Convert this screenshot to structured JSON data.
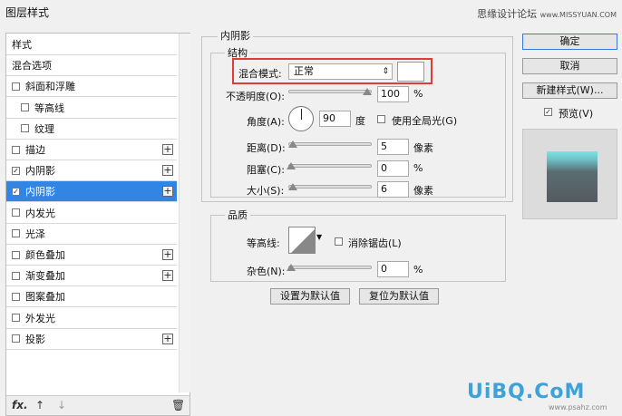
{
  "window": {
    "title": "图层样式",
    "watermark_top": "思缘设计论坛",
    "watermark_top_url": "www.MISSYUAN.COM"
  },
  "left_list": {
    "items": [
      {
        "label": "样式",
        "checkbox": false,
        "checked": false,
        "plus": false,
        "indent": 0,
        "selected": false
      },
      {
        "label": "混合选项",
        "checkbox": false,
        "checked": false,
        "plus": false,
        "indent": 0,
        "selected": false
      },
      {
        "label": "斜面和浮雕",
        "checkbox": true,
        "checked": false,
        "plus": false,
        "indent": 0,
        "selected": false
      },
      {
        "label": "等高线",
        "checkbox": true,
        "checked": false,
        "plus": false,
        "indent": 1,
        "selected": false
      },
      {
        "label": "纹理",
        "checkbox": true,
        "checked": false,
        "plus": false,
        "indent": 1,
        "selected": false
      },
      {
        "label": "描边",
        "checkbox": true,
        "checked": false,
        "plus": true,
        "indent": 0,
        "selected": false
      },
      {
        "label": "内阴影",
        "checkbox": true,
        "checked": true,
        "plus": true,
        "indent": 0,
        "selected": false
      },
      {
        "label": "内阴影",
        "checkbox": true,
        "checked": true,
        "plus": true,
        "indent": 0,
        "selected": true
      },
      {
        "label": "内发光",
        "checkbox": true,
        "checked": false,
        "plus": false,
        "indent": 0,
        "selected": false
      },
      {
        "label": "光泽",
        "checkbox": true,
        "checked": false,
        "plus": false,
        "indent": 0,
        "selected": false
      },
      {
        "label": "颜色叠加",
        "checkbox": true,
        "checked": false,
        "plus": true,
        "indent": 0,
        "selected": false
      },
      {
        "label": "渐变叠加",
        "checkbox": true,
        "checked": false,
        "plus": true,
        "indent": 0,
        "selected": false
      },
      {
        "label": "图案叠加",
        "checkbox": true,
        "checked": false,
        "plus": false,
        "indent": 0,
        "selected": false
      },
      {
        "label": "外发光",
        "checkbox": true,
        "checked": false,
        "plus": false,
        "indent": 0,
        "selected": false
      },
      {
        "label": "投影",
        "checkbox": true,
        "checked": false,
        "plus": true,
        "indent": 0,
        "selected": false
      }
    ],
    "bottom": {
      "fx": "fx.",
      "up": "↑",
      "down": "↓",
      "trash": "🗑"
    }
  },
  "panel": {
    "section": "内阴影",
    "structure": {
      "group": "结构",
      "blend_mode_label": "混合模式:",
      "blend_mode_value": "正常",
      "opacity_label": "不透明度(O):",
      "opacity_value": "100",
      "opacity_unit": "%",
      "opacity_level": 1.0,
      "angle_label": "角度(A):",
      "angle_value": "90",
      "angle_unit": "度",
      "global_light_label": "使用全局光(G)",
      "distance_label": "距离(D):",
      "distance_value": "5",
      "distance_unit": "像素",
      "choke_label": "阻塞(C):",
      "choke_value": "0",
      "choke_unit": "%",
      "size_label": "大小(S):",
      "size_value": "6",
      "size_unit": "像素"
    },
    "quality": {
      "group": "品质",
      "contour_label": "等高线:",
      "antialias_label": "消除锯齿(L)",
      "noise_label": "杂色(N):",
      "noise_value": "0",
      "noise_unit": "%"
    },
    "buttons": {
      "set_default": "设置为默认值",
      "reset_default": "复位为默认值"
    }
  },
  "right": {
    "ok": "确定",
    "cancel": "取消",
    "new_style": "新建样式(W)...",
    "preview_label": "预览(V)"
  },
  "watermark_bottom": {
    "logo": "UiBQ.CoM",
    "url": "www.psahz.com"
  }
}
